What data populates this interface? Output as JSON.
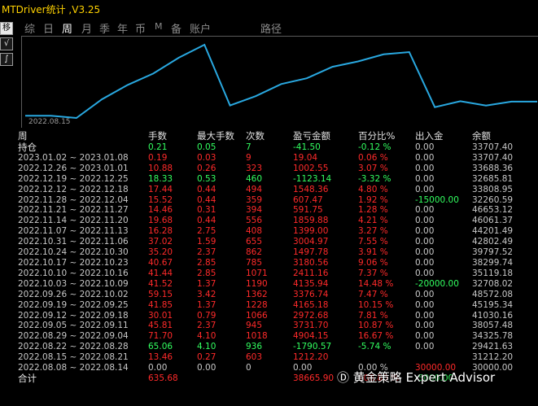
{
  "window": {
    "title": "MTDriver统计 ,V3.25"
  },
  "side_toolbar": {
    "buttons": [
      {
        "label": "移",
        "icon": "move-icon"
      },
      {
        "label": "√",
        "icon": "check-icon"
      },
      {
        "label": "∫",
        "icon": "integral-icon"
      }
    ]
  },
  "tabs": [
    {
      "label": "综",
      "active": false
    },
    {
      "label": "日",
      "active": false
    },
    {
      "label": "周",
      "active": true
    },
    {
      "label": "月",
      "active": false
    },
    {
      "label": "季",
      "active": false
    },
    {
      "label": "年",
      "active": false
    },
    {
      "label": "币",
      "active": false
    },
    {
      "label": "M",
      "active": false
    },
    {
      "label": "备",
      "active": false
    },
    {
      "label": "账户",
      "active": false
    },
    {
      "label": "路径",
      "active": false
    }
  ],
  "chart": {
    "date_label": "2022.08.15",
    "line_color": "#29a8e0",
    "equity_curve": [
      30000.0,
      30000.0,
      29421.63,
      34325.78,
      38057.48,
      41030.16,
      45195.34,
      48572.08,
      32708.02,
      35119.18,
      38299.74,
      39797.52,
      42802.49,
      44201.49,
      46061.37,
      46653.12,
      32260.59,
      33808.95,
      32685.81,
      33688.36,
      33707.4
    ]
  },
  "table": {
    "headers": {
      "week": "周",
      "hands": "手数",
      "max_hands": "最大手数",
      "count": "次数",
      "pl": "盈亏金额",
      "pct": "百分比%",
      "io": "出入金",
      "balance": "余额"
    },
    "holding": {
      "week": "持仓",
      "hands": "0.21",
      "max_hands": "0.05",
      "count": "7",
      "pl": "-41.50",
      "pct": "-0.12 %",
      "io": "0.00",
      "balance": "33707.40",
      "tone": "pos"
    },
    "rows": [
      {
        "week": "2023.01.02 ~ 2023.01.08",
        "hands": "0.19",
        "max_hands": "0.03",
        "count": "9",
        "pl": "19.04",
        "pct": "0.06 %",
        "io": "0.00",
        "balance": "33707.40",
        "tone": "neg",
        "io_tone": "neu"
      },
      {
        "week": "2022.12.26 ~ 2023.01.01",
        "hands": "10.88",
        "max_hands": "0.26",
        "count": "323",
        "pl": "1002.55",
        "pct": "3.07 %",
        "io": "0.00",
        "balance": "33688.36",
        "tone": "neg",
        "io_tone": "neu"
      },
      {
        "week": "2022.12.19 ~ 2022.12.25",
        "hands": "18.33",
        "max_hands": "0.53",
        "count": "460",
        "pl": "-1123.14",
        "pct": "-3.32 %",
        "io": "0.00",
        "balance": "32685.81",
        "tone": "pos",
        "io_tone": "neu"
      },
      {
        "week": "2022.12.12 ~ 2022.12.18",
        "hands": "17.44",
        "max_hands": "0.44",
        "count": "494",
        "pl": "1548.36",
        "pct": "4.80 %",
        "io": "0.00",
        "balance": "33808.95",
        "tone": "neg",
        "io_tone": "neu"
      },
      {
        "week": "2022.11.28 ~ 2022.12.04",
        "hands": "15.52",
        "max_hands": "0.44",
        "count": "359",
        "pl": "607.47",
        "pct": "1.92 %",
        "io": "-15000.00",
        "balance": "32260.59",
        "tone": "neg",
        "io_tone": "pos-io"
      },
      {
        "week": "2022.11.21 ~ 2022.11.27",
        "hands": "14.46",
        "max_hands": "0.31",
        "count": "394",
        "pl": "591.75",
        "pct": "1.28 %",
        "io": "0.00",
        "balance": "46653.12",
        "tone": "neg",
        "io_tone": "neu"
      },
      {
        "week": "2022.11.14 ~ 2022.11.20",
        "hands": "19.68",
        "max_hands": "0.44",
        "count": "556",
        "pl": "1859.88",
        "pct": "4.21 %",
        "io": "0.00",
        "balance": "46061.37",
        "tone": "neg",
        "io_tone": "neu"
      },
      {
        "week": "2022.11.07 ~ 2022.11.13",
        "hands": "16.28",
        "max_hands": "2.75",
        "count": "408",
        "pl": "1399.00",
        "pct": "3.27 %",
        "io": "0.00",
        "balance": "44201.49",
        "tone": "neg",
        "io_tone": "neu"
      },
      {
        "week": "2022.10.31 ~ 2022.11.06",
        "hands": "37.02",
        "max_hands": "1.59",
        "count": "655",
        "pl": "3004.97",
        "pct": "7.55 %",
        "io": "0.00",
        "balance": "42802.49",
        "tone": "neg",
        "io_tone": "neu"
      },
      {
        "week": "2022.10.24 ~ 2022.10.30",
        "hands": "35.20",
        "max_hands": "2.37",
        "count": "862",
        "pl": "1497.78",
        "pct": "3.91 %",
        "io": "0.00",
        "balance": "39797.52",
        "tone": "neg",
        "io_tone": "neu"
      },
      {
        "week": "2022.10.17 ~ 2022.10.23",
        "hands": "40.67",
        "max_hands": "2.85",
        "count": "785",
        "pl": "3180.56",
        "pct": "9.06 %",
        "io": "0.00",
        "balance": "38299.74",
        "tone": "neg",
        "io_tone": "neu"
      },
      {
        "week": "2022.10.10 ~ 2022.10.16",
        "hands": "41.44",
        "max_hands": "2.85",
        "count": "1071",
        "pl": "2411.16",
        "pct": "7.37 %",
        "io": "0.00",
        "balance": "35119.18",
        "tone": "neg",
        "io_tone": "neu"
      },
      {
        "week": "2022.10.03 ~ 2022.10.09",
        "hands": "41.52",
        "max_hands": "1.37",
        "count": "1190",
        "pl": "4135.94",
        "pct": "14.48 %",
        "io": "-20000.00",
        "balance": "32708.02",
        "tone": "neg",
        "io_tone": "pos-io"
      },
      {
        "week": "2022.09.26 ~ 2022.10.02",
        "hands": "59.15",
        "max_hands": "3.42",
        "count": "1362",
        "pl": "3376.74",
        "pct": "7.47 %",
        "io": "0.00",
        "balance": "48572.08",
        "tone": "neg",
        "io_tone": "neu"
      },
      {
        "week": "2022.09.19 ~ 2022.09.25",
        "hands": "41.85",
        "max_hands": "1.37",
        "count": "1228",
        "pl": "4165.18",
        "pct": "10.15 %",
        "io": "0.00",
        "balance": "45195.34",
        "tone": "neg",
        "io_tone": "neu"
      },
      {
        "week": "2022.09.12 ~ 2022.09.18",
        "hands": "30.01",
        "max_hands": "0.79",
        "count": "1066",
        "pl": "2972.68",
        "pct": "7.81 %",
        "io": "0.00",
        "balance": "41030.16",
        "tone": "neg",
        "io_tone": "neu"
      },
      {
        "week": "2022.09.05 ~ 2022.09.11",
        "hands": "45.81",
        "max_hands": "2.37",
        "count": "945",
        "pl": "3731.70",
        "pct": "10.87 %",
        "io": "0.00",
        "balance": "38057.48",
        "tone": "neg",
        "io_tone": "neu"
      },
      {
        "week": "2022.08.29 ~ 2022.09.04",
        "hands": "71.70",
        "max_hands": "4.10",
        "count": "1018",
        "pl": "4904.15",
        "pct": "16.67 %",
        "io": "0.00",
        "balance": "34325.78",
        "tone": "neg",
        "io_tone": "neu"
      },
      {
        "week": "2022.08.22 ~ 2022.08.28",
        "hands": "65.06",
        "max_hands": "4.10",
        "count": "936",
        "pl": "-1790.57",
        "pct": "-5.74 %",
        "io": "0.00",
        "balance": "29421.63",
        "tone": "pos",
        "io_tone": "neu"
      },
      {
        "week": "2022.08.15 ~ 2022.08.21",
        "hands": "13.46",
        "max_hands": "0.27",
        "count": "603",
        "pl": "1212.20",
        "pct": "",
        "io": "",
        "balance": "31212.20",
        "tone": "neg",
        "io_tone": "neu"
      },
      {
        "week": "2022.08.08 ~ 2022.08.14",
        "hands": "0.00",
        "max_hands": "0.00",
        "count": "0",
        "pl": "0.00",
        "pct": "0.00 %",
        "io": "30000.00",
        "balance": "30000.00",
        "tone": "neu",
        "io_tone": "neg"
      }
    ],
    "total": {
      "week": "合计",
      "hands": "635.68",
      "max_hands": "",
      "count": "",
      "pl": "38665.90",
      "pct": "108.80 %",
      "io": "-5000.00",
      "balance": "",
      "tone": "neg",
      "io_tone": "pos-io"
    }
  },
  "watermark": {
    "icon": "social-logo-icon",
    "text": "黄金策略 Expert Advisor"
  }
}
